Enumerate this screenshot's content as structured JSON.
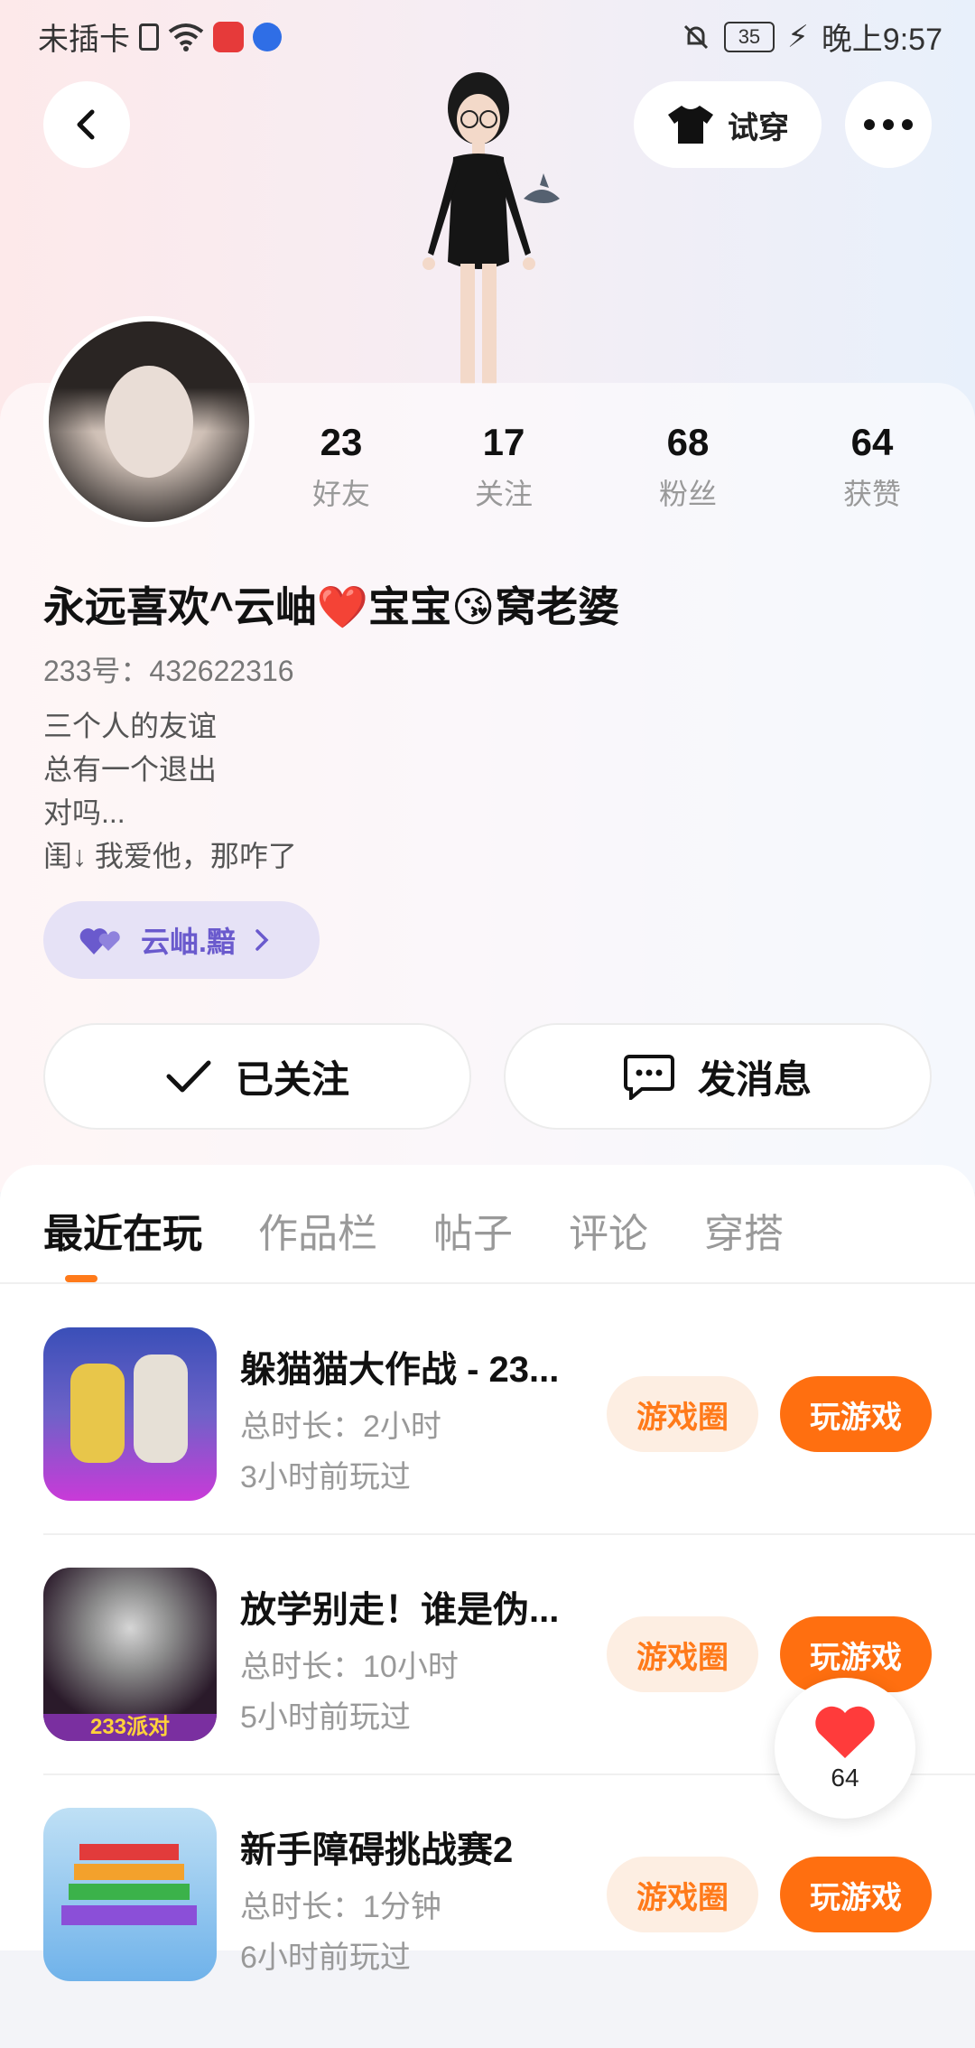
{
  "status_bar": {
    "carrier": "未插卡",
    "time": "晚上9:57",
    "battery": "35"
  },
  "header": {
    "try_on_label": "试穿"
  },
  "profile": {
    "stats": [
      {
        "value": "23",
        "label": "好友"
      },
      {
        "value": "17",
        "label": "关注"
      },
      {
        "value": "68",
        "label": "粉丝"
      },
      {
        "value": "64",
        "label": "获赞"
      }
    ],
    "nickname": "永远喜欢^云岫❤️宝宝😘窝老婆",
    "id_line": "233号：432622316",
    "bio": [
      "三个人的友谊",
      "总有一个退出",
      "对吗...",
      "闺↓ 我爱他，那咋了"
    ],
    "relation_chip": "云岫.黯"
  },
  "actions": {
    "followed_label": "已关注",
    "message_label": "发消息"
  },
  "tabs": [
    "最近在玩",
    "作品栏",
    "帖子",
    "评论",
    "穿搭"
  ],
  "games": [
    {
      "title": "躲猫猫大作战 - 23...",
      "duration": "总时长：2小时",
      "last_played": "3小时前玩过",
      "circle_label": "游戏圈",
      "play_label": "玩游戏"
    },
    {
      "title": "放学别走！谁是伪...",
      "duration": "总时长：10小时",
      "last_played": "5小时前玩过",
      "circle_label": "游戏圈",
      "play_label": "玩游戏"
    },
    {
      "title": "新手障碍挑战赛2",
      "duration": "总时长：1分钟",
      "last_played": "6小时前玩过",
      "circle_label": "游戏圈",
      "play_label": "玩游戏"
    }
  ],
  "like_float": {
    "count": "64"
  },
  "colors": {
    "accent": "#ff6f10",
    "accent_light": "#fdeee2",
    "chip_bg": "#e6e2f6",
    "chip_text": "#6a5acd"
  }
}
